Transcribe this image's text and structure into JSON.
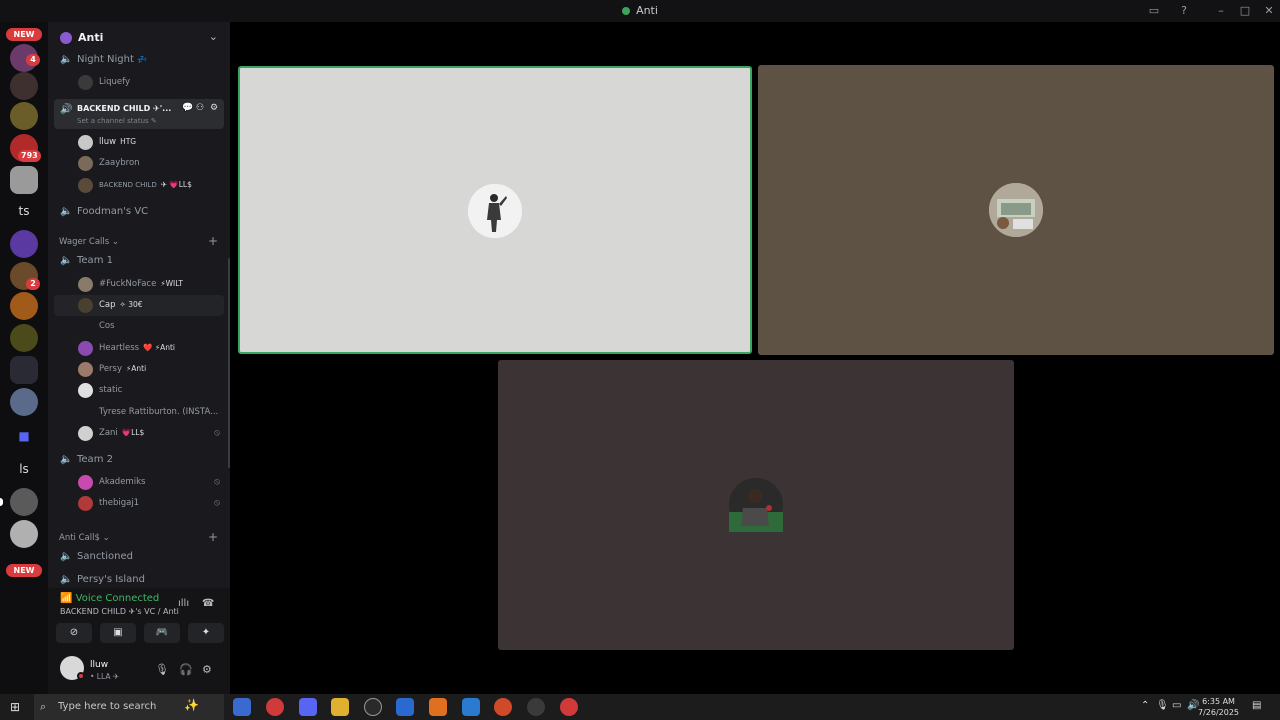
{
  "window": {
    "title": "Anti"
  },
  "rail": {
    "new_top": "NEW",
    "new_bottom": "NEW",
    "badges": [
      "4",
      "793",
      "2"
    ],
    "text_servers": [
      "ts",
      "ls"
    ]
  },
  "guild": {
    "name": "Anti"
  },
  "channels": {
    "night_night": "Night Night",
    "night_night_emoji": "💤",
    "liquefy": "Liquefy",
    "backend_child": "BACKEND CHILD",
    "backend_child_suffix": "✈'...",
    "backend_child_status": "Set a channel status",
    "backend_users": [
      {
        "name": "lluw",
        "tag": "HTG"
      },
      {
        "name": "Zaaybron",
        "tag": ""
      },
      {
        "name": "BACKEND CHILD",
        "tag": "✈ 💗LL$"
      }
    ],
    "foodman": "Foodman's VC",
    "wager_calls": "Wager Calls",
    "team1": "Team 1",
    "team1_users": [
      {
        "name": "#FuckNoFace",
        "tag": "⚡WILT"
      },
      {
        "name": "Cap",
        "tag": "✧ 30€"
      },
      {
        "name": "Cos",
        "tag": ""
      },
      {
        "name": "Heartless",
        "tag": "❤️ ⚡Anti"
      },
      {
        "name": "Persy",
        "tag": "⚡Anti"
      },
      {
        "name": "static",
        "tag": ""
      },
      {
        "name": "Tyrese Rattiburton. (INSTA...",
        "tag": ""
      },
      {
        "name": "Zani",
        "tag": "💗LL$"
      }
    ],
    "team2": "Team 2",
    "team2_users": [
      {
        "name": "Akademiks",
        "tag": ""
      },
      {
        "name": "thebigaj1",
        "tag": ""
      }
    ],
    "anti_calls": "Anti Call$",
    "sanctioned": "Sanctioned",
    "persys_island": "Persy's Island"
  },
  "voice": {
    "status": "Voice Connected",
    "location": "BACKEND CHILD ✈'s VC / Anti"
  },
  "me": {
    "name": "lluw",
    "sub": "• LLA ✈"
  },
  "taskbar": {
    "search_placeholder": "Type here to search",
    "time": "6:35 AM",
    "date": "7/26/2025"
  },
  "colors": {
    "speaking_border": "#3ba55d",
    "tile1": "#d7d7d6",
    "tile2": "#5e5244",
    "tile3": "#3c3434",
    "voice_connected": "#43b566",
    "badge": "#d83c3e"
  }
}
